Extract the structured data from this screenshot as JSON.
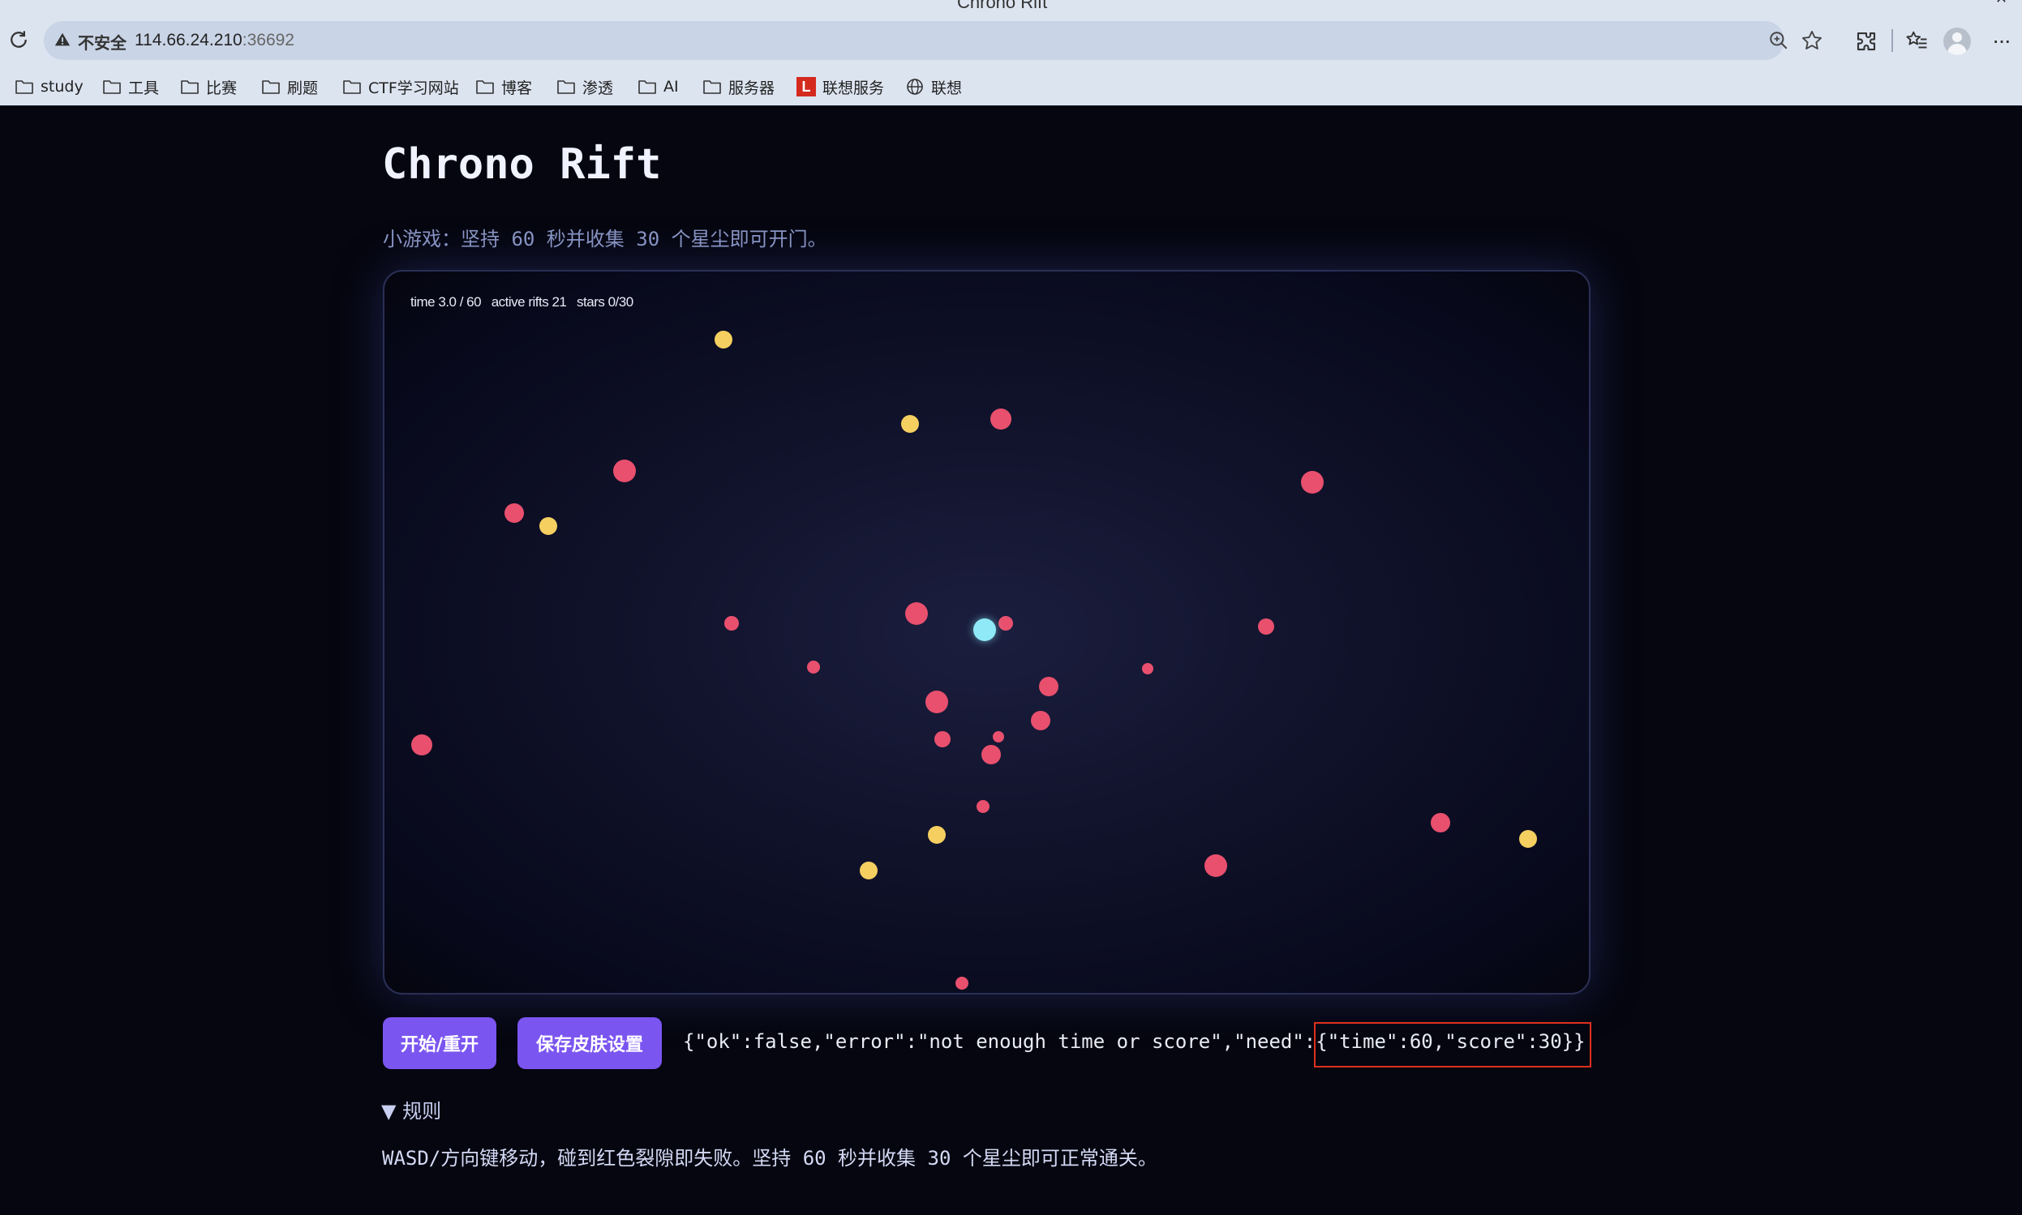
{
  "browser": {
    "tab_title": "Chrono Rift",
    "security_label": "不安全",
    "url_host": "114.66.24.210",
    "url_port": ":36692",
    "bookmarks": [
      {
        "label": "study",
        "icon": "folder-icon"
      },
      {
        "label": "工具",
        "icon": "folder-icon"
      },
      {
        "label": "比赛",
        "icon": "folder-icon"
      },
      {
        "label": "刷题",
        "icon": "folder-icon"
      },
      {
        "label": "CTF学习网站",
        "icon": "folder-icon"
      },
      {
        "label": "博客",
        "icon": "folder-icon"
      },
      {
        "label": "渗透",
        "icon": "folder-icon"
      },
      {
        "label": "AI",
        "icon": "folder-icon"
      },
      {
        "label": "服务器",
        "icon": "folder-icon"
      },
      {
        "label": "联想服务",
        "icon": "lenovo-l-icon",
        "badge": "L"
      },
      {
        "label": "联想",
        "icon": "globe-icon"
      }
    ]
  },
  "page": {
    "title": "Chrono Rift",
    "subtitle": "小游戏：坚持 60 秒并收集 30 个星尘即可开门。",
    "hud_text": "time 3.0 / 60   active rifts 21   stars 0/30",
    "buttons": {
      "start": "开始/重开",
      "save_skin": "保存皮肤设置"
    },
    "response_prefix": "{\"ok\":false,\"error\":\"not enough time or score\",\"need\":",
    "response_highlight": "{\"time\":60,\"score\":30}}",
    "rules_summary": "▼ 规则",
    "rules_text": "WASD/方向键移动，碰到红色裂隙即失败。坚持 60 秒并收集 30 个星尘即可正常通关。"
  },
  "colors": {
    "rift": "#e8506e",
    "star": "#f5cf60",
    "player": "#8fe9f7",
    "button": "#7b55f0",
    "highlight_border": "#e0301e"
  },
  "game": {
    "time_elapsed": 3.0,
    "time_required": 60,
    "active_rifts": 21,
    "stars_collected": 0,
    "stars_required": 30
  }
}
